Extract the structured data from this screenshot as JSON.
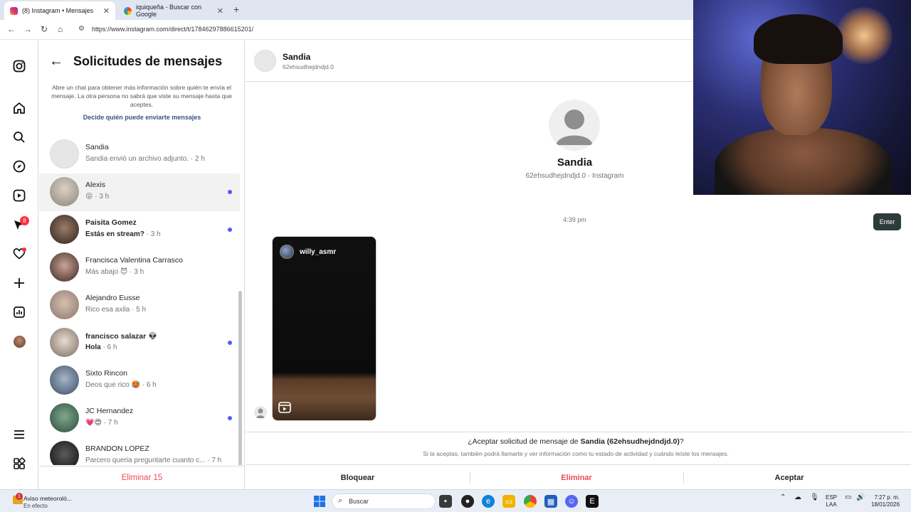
{
  "browser": {
    "tabs": [
      {
        "label": "(8) Instagram • Mensajes",
        "active": true
      },
      {
        "label": "iquiqueña - Buscar con Google",
        "active": false
      }
    ],
    "url": "https://www.instagram.com/direct/t/17846297886615201/"
  },
  "rail": {
    "icons": [
      "instagram-icon",
      "home-icon",
      "search-icon",
      "explore-icon",
      "reels-icon",
      "messenger-icon",
      "heart-icon",
      "create-icon",
      "dashboard-icon",
      "profile-avatar",
      "menu-icon",
      "more-icon"
    ],
    "messenger_badge": "8"
  },
  "requests": {
    "title": "Solicitudes de mensajes",
    "info": "Abre un chat para obtener más información sobre quién te envía el mensaje. La otra persona no sabrá que viste su mensaje hasta que aceptes.",
    "link": "Decide quién puede enviarte mensajes",
    "items": [
      {
        "name": "Sandia",
        "preview": "Sandia envió un archivo adjunto.",
        "time": "· 2 h",
        "unread": false,
        "selected": false
      },
      {
        "name": "Alexis",
        "preview": "😝",
        "time": "· 3 h",
        "unread": false,
        "selected": true,
        "dot": true
      },
      {
        "name": "Paisita Gomez",
        "preview": "Estás en stream?",
        "time": "· 3 h",
        "unread": true,
        "dot": true
      },
      {
        "name": "Francisca Valentina Carrasco",
        "preview": "Más abajo 😈",
        "time": "· 3 h",
        "unread": false
      },
      {
        "name": "Alejandro Eusse",
        "preview": "Rico esa axila",
        "time": "· 5 h",
        "unread": false
      },
      {
        "name": "francisco salazar 👽",
        "preview": "Hola",
        "time": "· 6 h",
        "unread": true,
        "dot": true
      },
      {
        "name": "Sixto Rincon",
        "preview": "Deos que rico 🥵",
        "time": "· 6 h",
        "unread": false
      },
      {
        "name": "JC Hernandez",
        "preview": "💗😍",
        "time": "· 7 h",
        "unread": true,
        "dot": true
      },
      {
        "name": "BRANDON LOPEZ",
        "preview": "Parcero queria preguntarte cuanto c...",
        "time": "· 7 h",
        "unread": false
      }
    ],
    "delete_all": "Eliminar 15"
  },
  "conversation": {
    "header_name": "Sandia",
    "header_user": "62ehsudhejdndjd.0",
    "profile_name": "Sandia",
    "profile_sub": "62ehsudhejdndjd.0 · Instagram",
    "timestamp": "4:39 pm",
    "reel_user": "willy_asmr",
    "accept_question_prefix": "¿Aceptar solicitud de mensaje de ",
    "accept_question_name": "Sandia (62ehsudhejdndjd.0)",
    "accept_question_suffix": "?",
    "accept_info": "Si la aceptas, también podrá llamarte y ver información como tu estado de actividad y cuándo leíste los mensajes.",
    "actions": {
      "block": "Bloquear",
      "delete": "Eliminar",
      "accept": "Aceptar"
    }
  },
  "overlay": {
    "enter_key": "Enter"
  },
  "taskbar": {
    "weather_title": "Aviso meteoroló...",
    "weather_sub": "En efecto",
    "weather_badge": "1",
    "search_placeholder": "Buscar",
    "lang_top": "ESP",
    "lang_bottom": "LAA",
    "time": "7:27 p. m.",
    "date": "18/01/2026"
  },
  "colors": {
    "unread_dot": "#4a5df9",
    "danger": "#ed4956",
    "link": "#385185",
    "badge": "#ff3040"
  }
}
